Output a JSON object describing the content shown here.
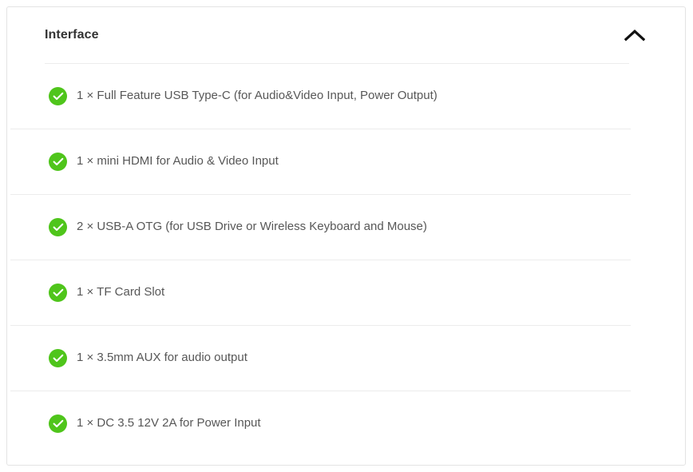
{
  "panel": {
    "title": "Interface",
    "collapse_icon": "chevron-up-icon",
    "expanded": true,
    "accent_color": "#4fc51b",
    "border_color": "#e3e3e3",
    "divider_color": "#ececec",
    "title_color": "#333333",
    "text_color": "#575757",
    "items": [
      {
        "icon": "check-circle-icon",
        "text": "1 × Full Feature USB Type-C (for Audio&Video Input, Power Output)"
      },
      {
        "icon": "check-circle-icon",
        "text": "1 × mini HDMI for Audio & Video Input"
      },
      {
        "icon": "check-circle-icon",
        "text": "2 × USB-A OTG (for USB Drive or Wireless Keyboard and Mouse)"
      },
      {
        "icon": "check-circle-icon",
        "text": "1 × TF Card Slot"
      },
      {
        "icon": "check-circle-icon",
        "text": "1 × 3.5mm AUX for audio output"
      },
      {
        "icon": "check-circle-icon",
        "text": "1 × DC 3.5 12V 2A for Power Input"
      }
    ]
  }
}
